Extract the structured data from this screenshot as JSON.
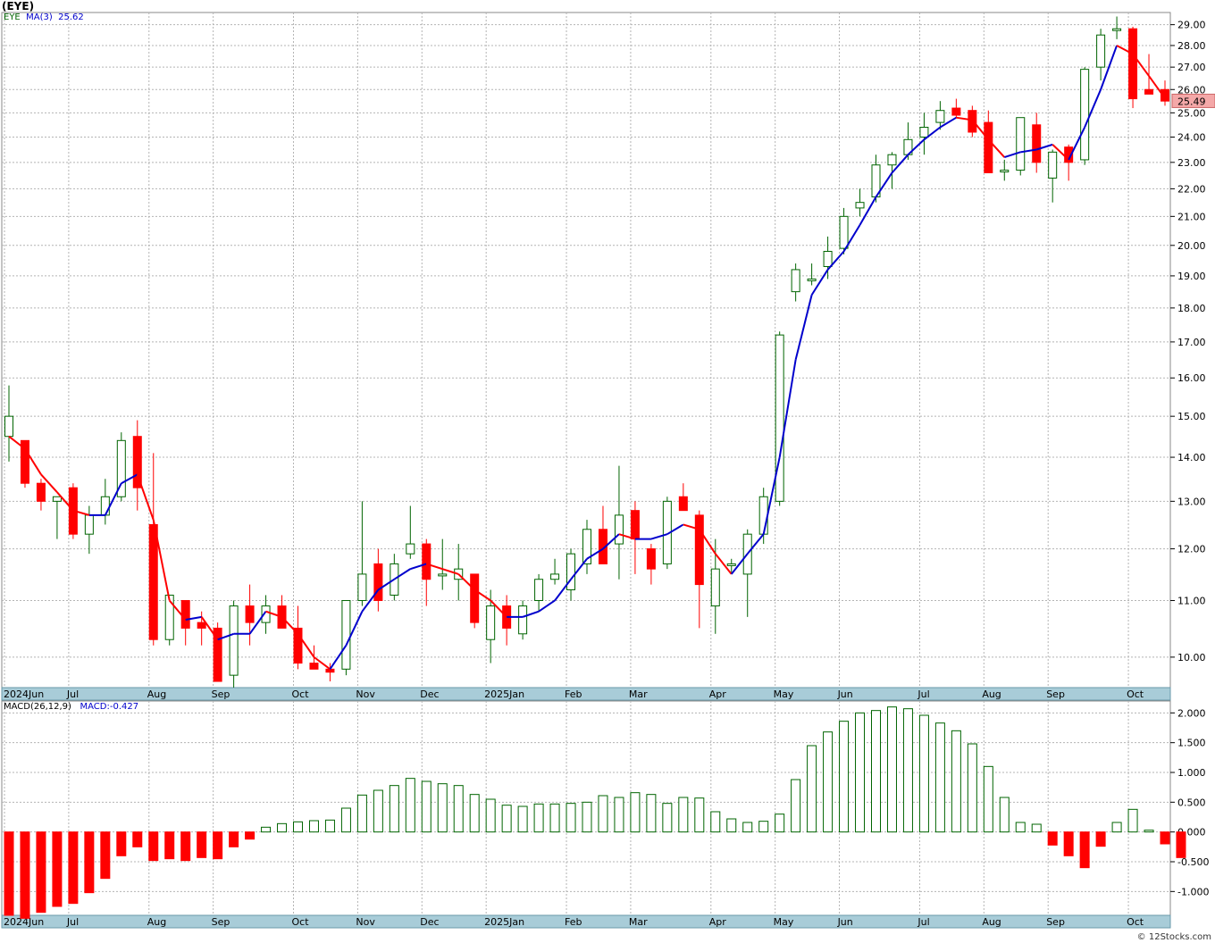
{
  "page": {
    "ticker_title": "(EYE)",
    "footer": "© 12Stocks.com"
  },
  "legend": {
    "ticker": "EYE",
    "ma_label": "MA(3)",
    "ma_value": "25.62",
    "macd_label": "MACD(26,12,9)",
    "macd_value": "MACD:-0.427"
  },
  "colors": {
    "up": "#006400",
    "down": "#ff0000",
    "ma_up": "#0000cc",
    "ma_down": "#ff0000",
    "axis_strip": "#a8ccd8",
    "grid": "#b4b4b4"
  },
  "chart_data": [
    {
      "type": "candlestick",
      "ylim": [
        9.5,
        29.6
      ],
      "y_scale": "log",
      "y_ticks": [
        "10.00",
        "11.00",
        "12.00",
        "13.00",
        "14.00",
        "15.00",
        "16.00",
        "17.00",
        "18.00",
        "19.00",
        "20.00",
        "21.00",
        "22.00",
        "23.00",
        "24.00",
        "25.00",
        "26.00",
        "27.00",
        "28.00",
        "29.00"
      ],
      "last_price_label": "25.49",
      "x_labels": [
        "2024Jun",
        "Jul",
        "Aug",
        "Sep",
        "Oct",
        "Nov",
        "Dec",
        "2025Jan",
        "Feb",
        "Mar",
        "Apr",
        "May",
        "Jun",
        "Jul",
        "Aug",
        "Sep",
        "Oct"
      ],
      "x_label_week_index": [
        0,
        4,
        9,
        13,
        18,
        22,
        26,
        30,
        35,
        39,
        44,
        48,
        52,
        57,
        61,
        65,
        70
      ],
      "candles": [
        {
          "o": 14.5,
          "h": 15.8,
          "l": 13.9,
          "c": 15.0
        },
        {
          "o": 14.4,
          "h": 14.4,
          "l": 13.3,
          "c": 13.4
        },
        {
          "o": 13.4,
          "h": 13.5,
          "l": 12.8,
          "c": 13.0
        },
        {
          "o": 13.0,
          "h": 13.1,
          "l": 12.2,
          "c": 13.1
        },
        {
          "o": 13.3,
          "h": 13.4,
          "l": 12.2,
          "c": 12.3
        },
        {
          "o": 12.3,
          "h": 12.9,
          "l": 11.9,
          "c": 12.7
        },
        {
          "o": 12.7,
          "h": 13.5,
          "l": 12.5,
          "c": 13.1
        },
        {
          "o": 13.1,
          "h": 14.6,
          "l": 13.0,
          "c": 14.4
        },
        {
          "o": 14.5,
          "h": 14.9,
          "l": 12.8,
          "c": 13.3
        },
        {
          "o": 12.5,
          "h": 14.1,
          "l": 10.2,
          "c": 10.3
        },
        {
          "o": 10.3,
          "h": 11.1,
          "l": 10.2,
          "c": 11.1
        },
        {
          "o": 11.0,
          "h": 11.0,
          "l": 10.2,
          "c": 10.5
        },
        {
          "o": 10.6,
          "h": 10.8,
          "l": 10.2,
          "c": 10.5
        },
        {
          "o": 10.5,
          "h": 10.6,
          "l": 9.6,
          "c": 9.6
        },
        {
          "o": 9.7,
          "h": 11.0,
          "l": 9.5,
          "c": 10.9
        },
        {
          "o": 10.9,
          "h": 11.3,
          "l": 10.2,
          "c": 10.6
        },
        {
          "o": 10.6,
          "h": 11.1,
          "l": 10.4,
          "c": 10.9
        },
        {
          "o": 10.9,
          "h": 11.1,
          "l": 10.5,
          "c": 10.5
        },
        {
          "o": 10.5,
          "h": 10.9,
          "l": 9.8,
          "c": 9.9
        },
        {
          "o": 9.9,
          "h": 10.2,
          "l": 9.8,
          "c": 9.8
        },
        {
          "o": 9.8,
          "h": 9.9,
          "l": 9.6,
          "c": 9.75
        },
        {
          "o": 9.8,
          "h": 11.0,
          "l": 9.7,
          "c": 11.0
        },
        {
          "o": 11.0,
          "h": 13.0,
          "l": 10.9,
          "c": 11.5
        },
        {
          "o": 11.7,
          "h": 12.0,
          "l": 10.8,
          "c": 11.0
        },
        {
          "o": 11.1,
          "h": 11.9,
          "l": 11.0,
          "c": 11.7
        },
        {
          "o": 11.9,
          "h": 12.9,
          "l": 11.8,
          "c": 12.1
        },
        {
          "o": 12.1,
          "h": 12.2,
          "l": 10.9,
          "c": 11.4
        },
        {
          "o": 11.5,
          "h": 12.2,
          "l": 11.2,
          "c": 11.5
        },
        {
          "o": 11.4,
          "h": 12.1,
          "l": 11.0,
          "c": 11.6
        },
        {
          "o": 11.5,
          "h": 11.5,
          "l": 10.5,
          "c": 10.6
        },
        {
          "o": 10.3,
          "h": 11.2,
          "l": 9.9,
          "c": 10.9
        },
        {
          "o": 10.9,
          "h": 11.1,
          "l": 10.2,
          "c": 10.5
        },
        {
          "o": 10.4,
          "h": 11.0,
          "l": 10.3,
          "c": 10.9
        },
        {
          "o": 11.0,
          "h": 11.5,
          "l": 10.8,
          "c": 11.4
        },
        {
          "o": 11.4,
          "h": 11.8,
          "l": 11.3,
          "c": 11.5
        },
        {
          "o": 11.2,
          "h": 12.0,
          "l": 11.0,
          "c": 11.9
        },
        {
          "o": 11.7,
          "h": 12.6,
          "l": 11.5,
          "c": 12.4
        },
        {
          "o": 12.4,
          "h": 12.9,
          "l": 11.8,
          "c": 11.7
        },
        {
          "o": 12.1,
          "h": 13.8,
          "l": 11.4,
          "c": 12.7
        },
        {
          "o": 12.8,
          "h": 13.0,
          "l": 11.5,
          "c": 12.2
        },
        {
          "o": 12.0,
          "h": 12.1,
          "l": 11.3,
          "c": 11.6
        },
        {
          "o": 11.7,
          "h": 13.1,
          "l": 11.6,
          "c": 13.0
        },
        {
          "o": 13.1,
          "h": 13.4,
          "l": 12.8,
          "c": 12.8
        },
        {
          "o": 12.7,
          "h": 12.8,
          "l": 10.5,
          "c": 11.3
        },
        {
          "o": 10.9,
          "h": 12.2,
          "l": 10.4,
          "c": 11.6
        },
        {
          "o": 11.7,
          "h": 11.8,
          "l": 11.5,
          "c": 11.7
        },
        {
          "o": 11.5,
          "h": 12.4,
          "l": 10.7,
          "c": 12.3
        },
        {
          "o": 12.3,
          "h": 13.3,
          "l": 12.1,
          "c": 13.1
        },
        {
          "o": 13.0,
          "h": 17.3,
          "l": 12.9,
          "c": 17.2
        },
        {
          "o": 18.5,
          "h": 19.4,
          "l": 18.2,
          "c": 19.2
        },
        {
          "o": 18.9,
          "h": 19.4,
          "l": 18.7,
          "c": 18.9
        },
        {
          "o": 19.3,
          "h": 20.3,
          "l": 18.9,
          "c": 19.8
        },
        {
          "o": 19.9,
          "h": 21.3,
          "l": 19.7,
          "c": 21.0
        },
        {
          "o": 21.3,
          "h": 22.0,
          "l": 21.0,
          "c": 21.5
        },
        {
          "o": 21.7,
          "h": 23.3,
          "l": 21.5,
          "c": 22.9
        },
        {
          "o": 22.9,
          "h": 23.4,
          "l": 22.0,
          "c": 23.3
        },
        {
          "o": 23.3,
          "h": 24.6,
          "l": 23.1,
          "c": 23.9
        },
        {
          "o": 24.0,
          "h": 25.0,
          "l": 23.3,
          "c": 24.4
        },
        {
          "o": 24.6,
          "h": 25.5,
          "l": 24.3,
          "c": 25.1
        },
        {
          "o": 25.2,
          "h": 25.6,
          "l": 24.8,
          "c": 24.9
        },
        {
          "o": 25.1,
          "h": 25.3,
          "l": 24.0,
          "c": 24.2
        },
        {
          "o": 24.6,
          "h": 25.1,
          "l": 22.6,
          "c": 22.6
        },
        {
          "o": 22.7,
          "h": 23.1,
          "l": 22.3,
          "c": 22.7
        },
        {
          "o": 22.7,
          "h": 24.8,
          "l": 22.5,
          "c": 24.8
        },
        {
          "o": 24.5,
          "h": 25.0,
          "l": 22.6,
          "c": 23.0
        },
        {
          "o": 22.4,
          "h": 23.5,
          "l": 21.5,
          "c": 23.4
        },
        {
          "o": 23.6,
          "h": 23.7,
          "l": 22.3,
          "c": 23.0
        },
        {
          "o": 23.1,
          "h": 27.0,
          "l": 22.9,
          "c": 26.9
        },
        {
          "o": 27.0,
          "h": 28.8,
          "l": 26.4,
          "c": 28.5
        },
        {
          "o": 28.8,
          "h": 29.4,
          "l": 28.3,
          "c": 28.8
        },
        {
          "o": 28.8,
          "h": 28.9,
          "l": 25.2,
          "c": 25.6
        },
        {
          "o": 26.0,
          "h": 27.6,
          "l": 25.8,
          "c": 25.8
        },
        {
          "o": 26.0,
          "h": 26.4,
          "l": 25.3,
          "c": 25.5
        }
      ],
      "series": [
        {
          "name": "MA(3)",
          "values": [
            14.5,
            14.2,
            13.6,
            13.2,
            12.8,
            12.7,
            12.7,
            13.4,
            13.6,
            12.6,
            11.0,
            10.65,
            10.7,
            10.3,
            10.4,
            10.4,
            10.8,
            10.7,
            10.4,
            10.0,
            9.8,
            10.2,
            10.8,
            11.2,
            11.4,
            11.6,
            11.7,
            11.6,
            11.5,
            11.2,
            11.0,
            10.7,
            10.7,
            10.8,
            11.0,
            11.4,
            11.8,
            12.0,
            12.3,
            12.2,
            12.2,
            12.3,
            12.5,
            12.4,
            11.9,
            11.5,
            11.9,
            12.3,
            14.0,
            16.5,
            18.4,
            19.2,
            19.8,
            20.7,
            21.7,
            22.6,
            23.3,
            23.9,
            24.4,
            24.8,
            24.7,
            23.9,
            23.2,
            23.4,
            23.5,
            23.7,
            23.1,
            24.4,
            26.0,
            28.0,
            27.6,
            26.6,
            25.62
          ]
        }
      ]
    },
    {
      "type": "bar",
      "title": "MACD(26,12,9)",
      "ylim": [
        -1.4,
        2.2
      ],
      "y_ticks": [
        "-1.000",
        "-0.500",
        "0.000",
        "0.500",
        "1.000",
        "1.500",
        "2.000"
      ],
      "values": [
        -1.4,
        -1.45,
        -1.35,
        -1.25,
        -1.2,
        -1.02,
        -0.78,
        -0.4,
        -0.25,
        -0.48,
        -0.45,
        -0.48,
        -0.43,
        -0.45,
        -0.25,
        -0.12,
        0.08,
        0.14,
        0.17,
        0.19,
        0.2,
        0.4,
        0.62,
        0.7,
        0.78,
        0.9,
        0.85,
        0.81,
        0.78,
        0.63,
        0.55,
        0.45,
        0.43,
        0.47,
        0.47,
        0.48,
        0.5,
        0.61,
        0.58,
        0.66,
        0.63,
        0.48,
        0.58,
        0.57,
        0.34,
        0.22,
        0.16,
        0.18,
        0.3,
        0.88,
        1.45,
        1.68,
        1.86,
        2.0,
        2.04,
        2.1,
        2.07,
        1.96,
        1.83,
        1.7,
        1.48,
        1.1,
        0.58,
        0.16,
        0.13,
        -0.22,
        -0.4,
        -0.6,
        -0.24,
        0.16,
        0.38,
        0.03,
        -0.2,
        -0.43
      ]
    }
  ]
}
